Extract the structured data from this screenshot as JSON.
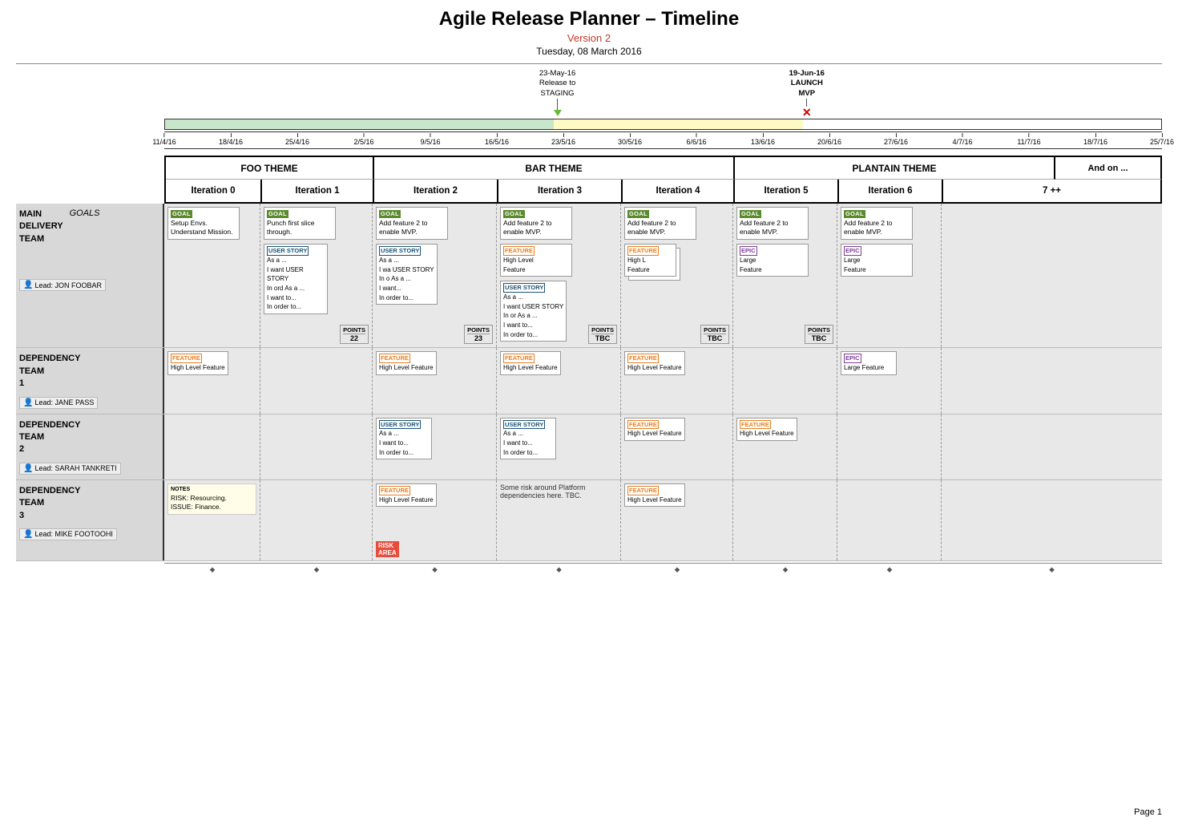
{
  "header": {
    "title": "Agile Release Planner – Timeline",
    "version": "Version 2",
    "date": "Tuesday, 08 March 2016"
  },
  "milestones": [
    {
      "id": "staging",
      "label": "23-May-16\nRelease to\nSTAGING",
      "type": "staging",
      "left_pct": 39
    },
    {
      "id": "launch",
      "label": "19-Jun-16\nLAUNCH\nMVP",
      "type": "launch",
      "left_pct": 64
    }
  ],
  "dates": [
    "11/4/16",
    "18/4/16",
    "25/4/16",
    "2/5/16",
    "9/5/16",
    "16/5/16",
    "23/5/16",
    "30/5/16",
    "6/6/16",
    "13/6/16",
    "20/6/16",
    "27/6/16",
    "4/7/16",
    "11/7/16",
    "18/7/16",
    "25/7/16"
  ],
  "themes": [
    {
      "label": "FOO THEME",
      "colspan": 2
    },
    {
      "label": "BAR THEME",
      "colspan": 3
    },
    {
      "label": "PLANTAIN THEME",
      "colspan": 2
    },
    {
      "label": "And on ...",
      "colspan": 1
    }
  ],
  "iterations": [
    {
      "label": "Iteration 0"
    },
    {
      "label": "Iteration 1"
    },
    {
      "label": "Iteration 2"
    },
    {
      "label": "Iteration 3"
    },
    {
      "label": "Iteration 4"
    },
    {
      "label": "Iteration 5"
    },
    {
      "label": "Iteration 6"
    },
    {
      "label": "7 ++"
    }
  ],
  "rows": [
    {
      "team": "MAIN\nDELIVERY\nTEAM",
      "goals_label": "GOALS",
      "lead": "Lead: JON FOOBAR",
      "cells": [
        {
          "iter": 0,
          "cards": [
            {
              "type": "goal",
              "tag": "GOAL",
              "text": "Setup Envs. Understand Mission."
            }
          ]
        },
        {
          "iter": 1,
          "cards": [
            {
              "type": "goal",
              "tag": "GOAL",
              "text": "Punch first slice through."
            },
            {
              "type": "user-story-stack",
              "stories": [
                {
                  "tag": "USER STORY",
                  "text": "As a ...\nI want USER STORY\nIn ord As a ...\nI want to...\nIn order to..."
                },
                {
                  "tag": "USER STORY",
                  "text": "As a ...\nI want to...\nIn order to..."
                }
              ]
            }
          ],
          "points": {
            "label": "POINTS",
            "value": "22"
          }
        },
        {
          "iter": 2,
          "cards": [
            {
              "type": "goal",
              "tag": "GOAL",
              "text": "Add feature 2 to enable MVP."
            },
            {
              "type": "user-story-stack",
              "stories": [
                {
                  "tag": "USER STORY",
                  "text": "As a ...\nI wa USER STORY\nIn o As a ...\nI want...\nIn order to..."
                },
                {
                  "tag": "USER STORY",
                  "text": "As a ...\nI want to...\nIn order to..."
                }
              ]
            }
          ],
          "points": {
            "label": "POINTS",
            "value": "23"
          }
        },
        {
          "iter": 3,
          "cards": [
            {
              "type": "goal",
              "tag": "GOAL",
              "text": "Add feature 2 to enable MVP."
            },
            {
              "type": "feature",
              "tag": "FEATURE",
              "text": "High Level Feature"
            },
            {
              "type": "user-story",
              "tag": "USER STORY",
              "text": "As a ...\nI want USER STORY\nIn or As a ...\nI want to...\nIn order to..."
            }
          ],
          "points": {
            "label": "POINTS",
            "value": "TBC"
          }
        },
        {
          "iter": 4,
          "cards": [
            {
              "type": "goal",
              "tag": "GOAL",
              "text": "Add feature 2 to enable MVP."
            },
            {
              "type": "feature",
              "tag": "FEATURE",
              "text": "High Level Feature"
            },
            {
              "type": "feature2",
              "tag": "FEATURE",
              "text": "High Level Feature"
            }
          ],
          "points": {
            "label": "POINTS",
            "value": "TBC"
          }
        },
        {
          "iter": 5,
          "cards": [
            {
              "type": "goal",
              "tag": "GOAL",
              "text": "Add feature 2 to enable MVP."
            },
            {
              "type": "epic",
              "tag": "EPIC",
              "text": "Large Feature"
            }
          ],
          "points": {
            "label": "POINTS",
            "value": "TBC"
          }
        },
        {
          "iter": 6,
          "cards": [
            {
              "type": "goal",
              "tag": "GOAL",
              "text": "Add feature 2 to enable MVP."
            },
            {
              "type": "epic",
              "tag": "EPIC",
              "text": "Large Feature"
            }
          ]
        },
        {
          "iter": 7,
          "cards": []
        }
      ]
    },
    {
      "team": "DEPENDENCY\nTEAM\n1",
      "lead": "Lead: JANE PASS",
      "cells": [
        {
          "iter": 0,
          "cards": [
            {
              "type": "feature",
              "tag": "FEATURE",
              "text": "High Level Feature"
            }
          ]
        },
        {
          "iter": 1,
          "cards": []
        },
        {
          "iter": 2,
          "cards": [
            {
              "type": "feature",
              "tag": "FEATURE",
              "text": "High Level Feature"
            }
          ]
        },
        {
          "iter": 3,
          "cards": [
            {
              "type": "feature",
              "tag": "FEATURE",
              "text": "High Level Feature"
            }
          ]
        },
        {
          "iter": 4,
          "cards": [
            {
              "type": "feature",
              "tag": "FEATURE",
              "text": "High Level Feature"
            }
          ]
        },
        {
          "iter": 5,
          "cards": []
        },
        {
          "iter": 6,
          "cards": [
            {
              "type": "epic",
              "tag": "EPIC",
              "text": "Large Feature"
            }
          ]
        },
        {
          "iter": 7,
          "cards": []
        }
      ]
    },
    {
      "team": "DEPENDENCY\nTEAM\n2",
      "lead": "Lead: SARAH TANKRETI",
      "cells": [
        {
          "iter": 0,
          "cards": []
        },
        {
          "iter": 1,
          "cards": []
        },
        {
          "iter": 2,
          "cards": [
            {
              "type": "user-story",
              "tag": "USER STORY",
              "text": "As a ...\nI want to...\nIn order to..."
            }
          ]
        },
        {
          "iter": 3,
          "cards": [
            {
              "type": "user-story",
              "tag": "USER STORY",
              "text": "As a ...\nI want to...\nIn order to..."
            }
          ]
        },
        {
          "iter": 4,
          "cards": [
            {
              "type": "feature",
              "tag": "FEATURE",
              "text": "High Level Feature"
            }
          ]
        },
        {
          "iter": 5,
          "cards": [
            {
              "type": "feature",
              "tag": "FEATURE",
              "text": "High Level Feature"
            }
          ]
        },
        {
          "iter": 6,
          "cards": []
        },
        {
          "iter": 7,
          "cards": []
        }
      ]
    },
    {
      "team": "DEPENDENCY\nTEAM\n3",
      "lead": "Lead: MIKE FOOTOOHI",
      "cells": [
        {
          "iter": 0,
          "cards": [],
          "notes": {
            "label": "NOTES",
            "text": "RISK: Resourcing.\nISSUE: Finance."
          }
        },
        {
          "iter": 1,
          "cards": []
        },
        {
          "iter": 2,
          "cards": [
            {
              "type": "feature",
              "tag": "FEATURE",
              "text": "High Level Feature"
            }
          ],
          "risk": "RISK\nAREA"
        },
        {
          "iter": 3,
          "cards": [],
          "risk_text": "Some risk around Platform dependencies here. TBC."
        },
        {
          "iter": 4,
          "cards": [
            {
              "type": "feature",
              "tag": "FEATURE",
              "text": "High Level Feature"
            }
          ]
        },
        {
          "iter": 5,
          "cards": []
        },
        {
          "iter": 6,
          "cards": []
        },
        {
          "iter": 7,
          "cards": []
        }
      ]
    }
  ],
  "page_number": "Page 1"
}
